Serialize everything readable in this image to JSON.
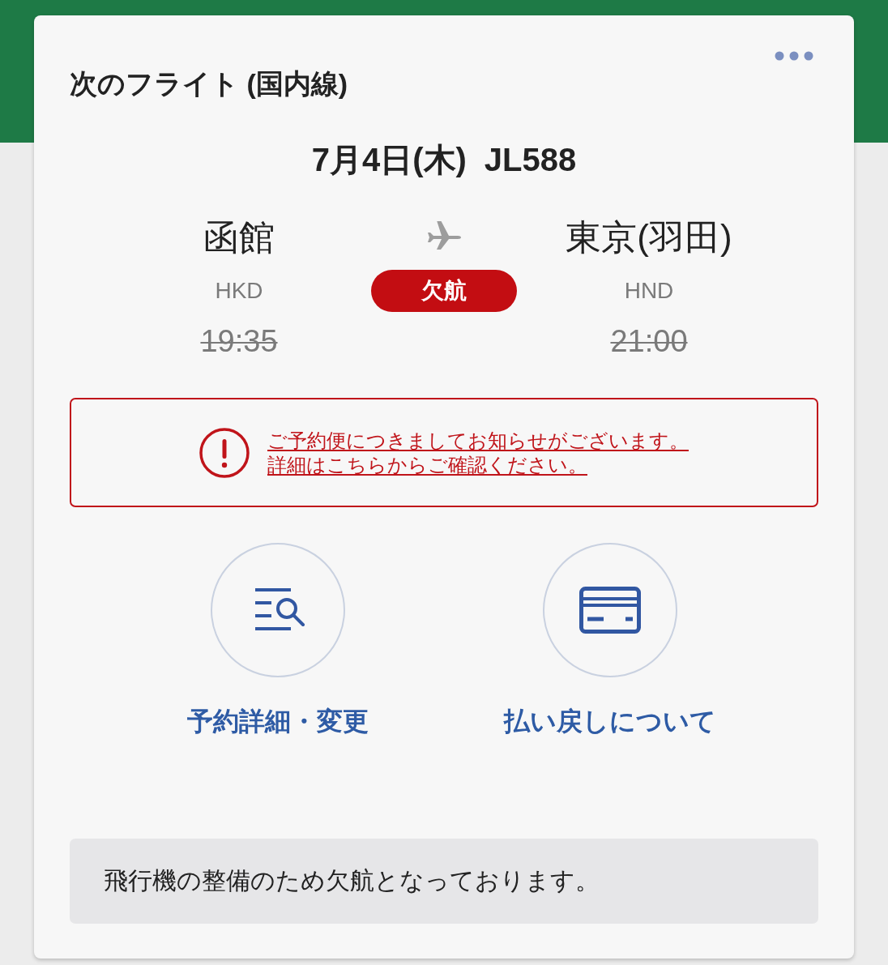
{
  "header": {
    "title": "次のフライト (国内線)"
  },
  "flight": {
    "date": "7月4日(木)",
    "number": "JL588"
  },
  "route": {
    "origin": {
      "city": "函館",
      "code": "HKD",
      "time": "19:35",
      "time_struck": true
    },
    "destination": {
      "city": "東京(羽田)",
      "code": "HND",
      "time": "21:00",
      "time_struck": true
    },
    "status": {
      "kind": "cancelled",
      "label": "欠航"
    }
  },
  "notice": {
    "kind": "alert",
    "lines": [
      "ご予約便につきましてお知らせがございます。",
      "詳細はこちらからご確認ください。"
    ]
  },
  "actions": [
    {
      "kind": "details",
      "label": "予約詳細・変更"
    },
    {
      "kind": "refund",
      "label": "払い戻しについて"
    }
  ],
  "message": "飛行機の整備のため欠航となっております。"
}
